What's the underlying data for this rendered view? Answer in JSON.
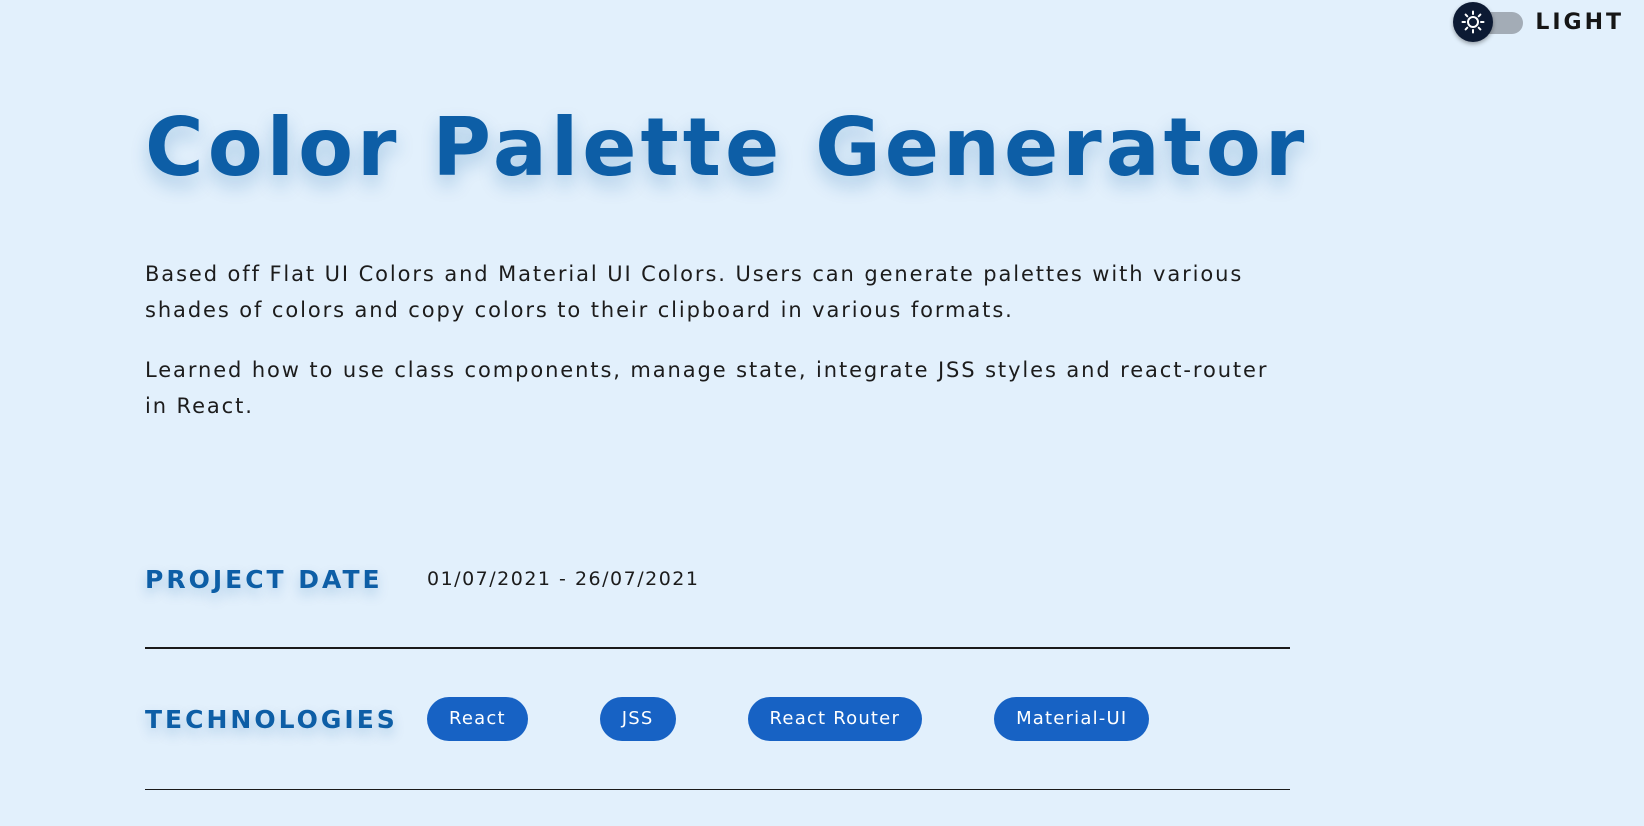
{
  "theme_toggle": {
    "label": "LIGHT",
    "icon": "sun-icon",
    "state": "light"
  },
  "project": {
    "title": "Color Palette Generator",
    "description": [
      "Based off Flat UI Colors and Material UI Colors. Users can generate palettes with various shades of colors and copy colors to their clipboard in various formats.",
      "Learned how to use class components, manage state, integrate JSS styles and react-router in React."
    ],
    "date_heading": "PROJECT DATE",
    "date_value": "01/07/2021 - 26/07/2021",
    "technologies_heading": "TECHNOLOGIES",
    "technologies": [
      "React",
      "JSS",
      "React Router",
      "Material-UI"
    ]
  },
  "colors": {
    "background": "#e2f0fc",
    "accent": "#0d5ea6",
    "tag_background": "#1762c4",
    "toggle_knob": "#0c1a33"
  }
}
